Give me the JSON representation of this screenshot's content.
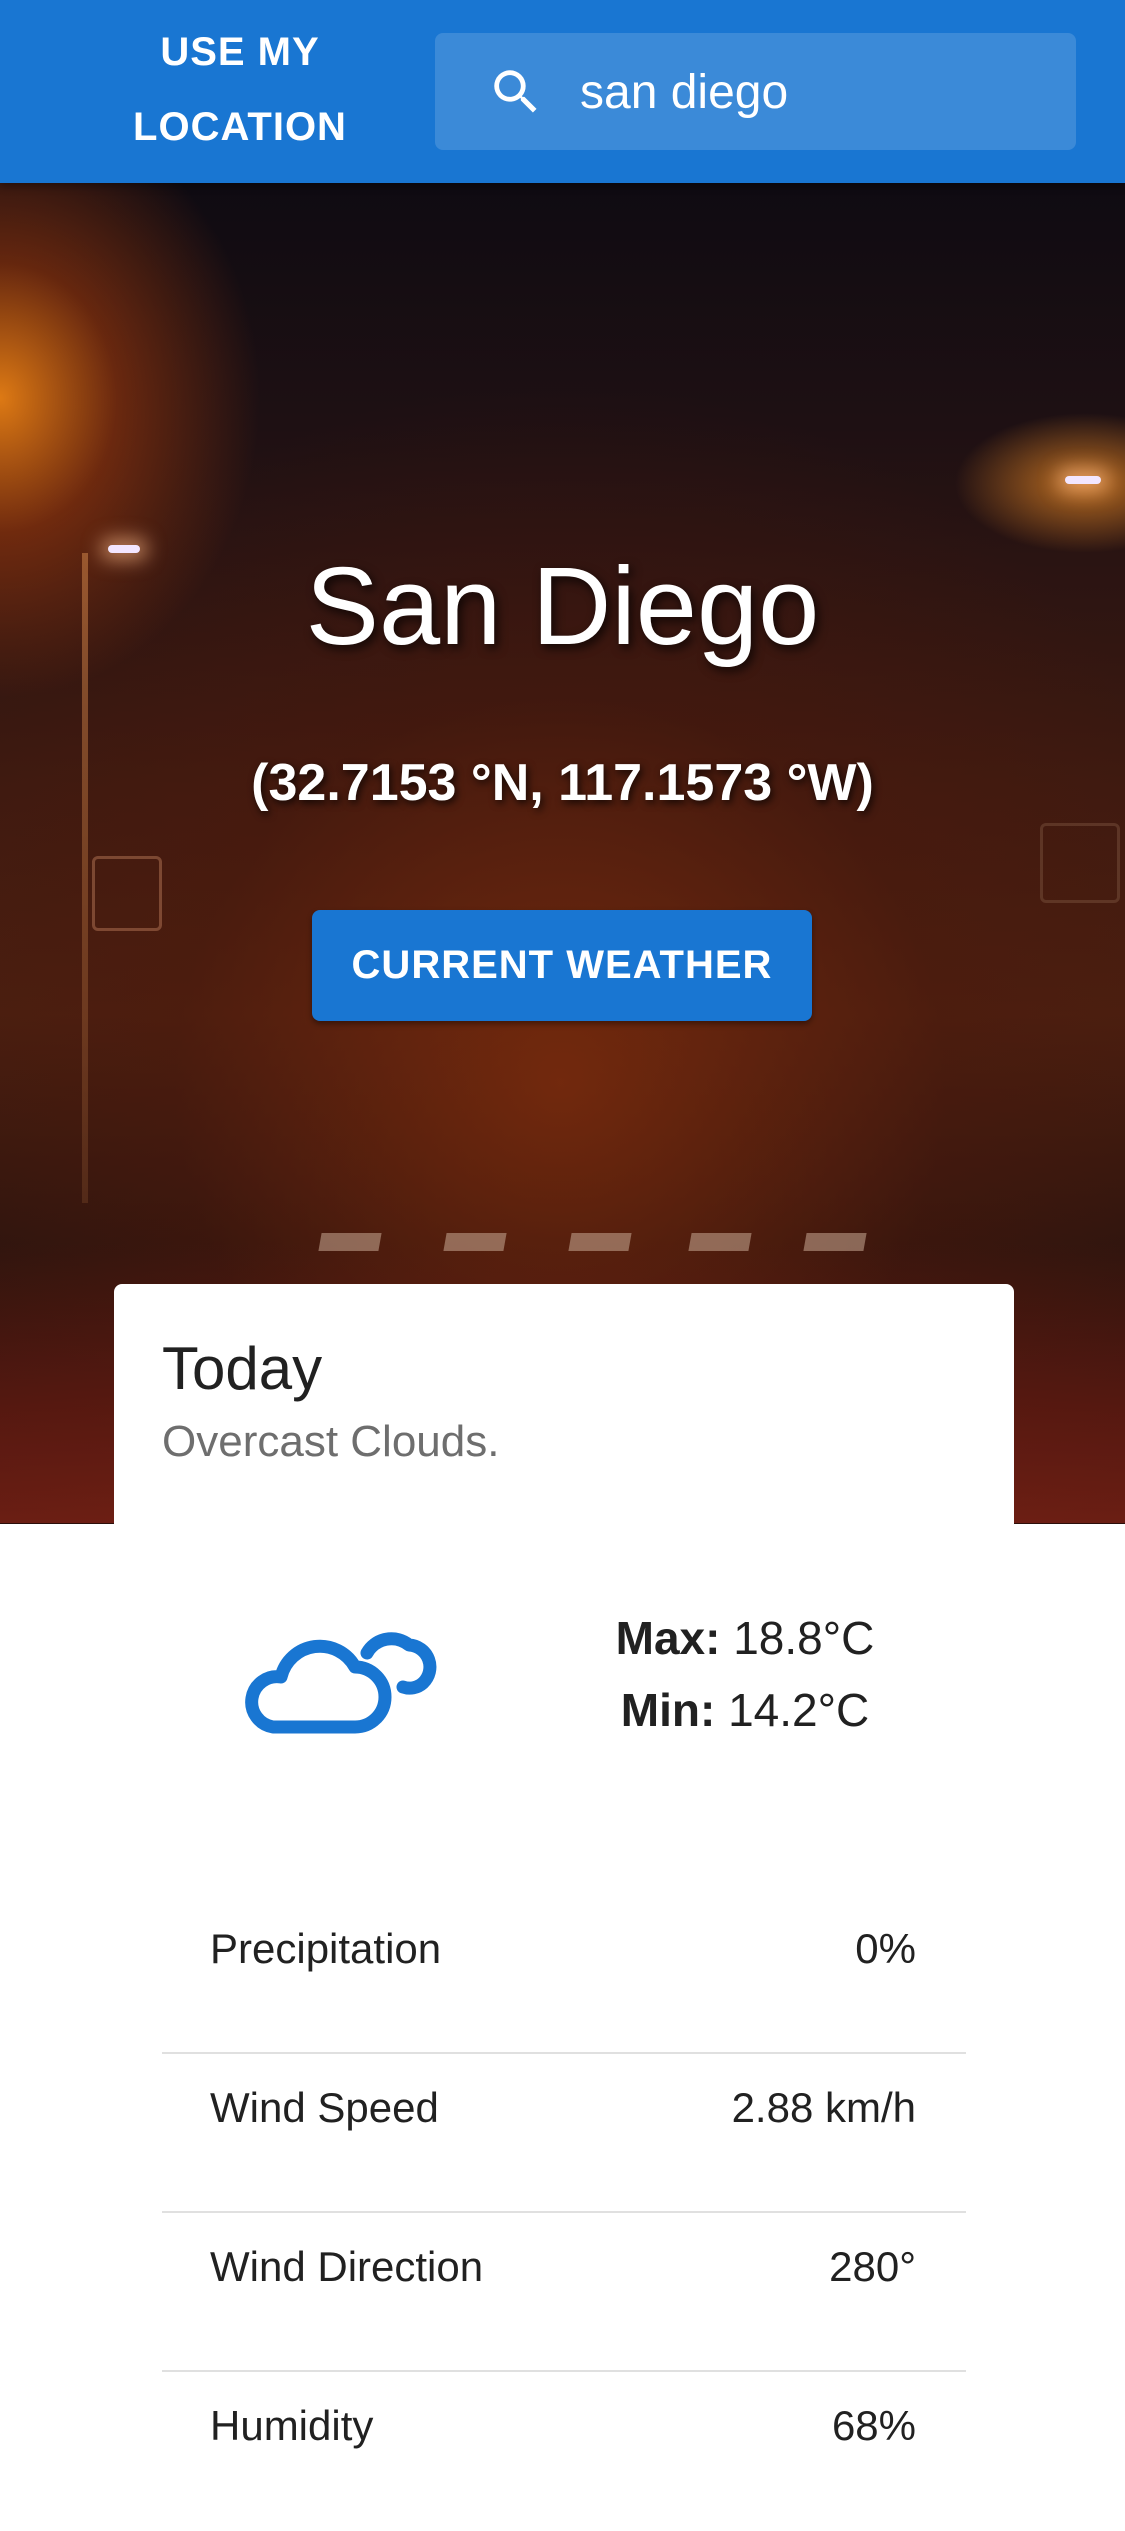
{
  "header": {
    "location_button_label": "USE MY\nLOCATION",
    "search": {
      "value": "san diego",
      "icon": "search-icon"
    }
  },
  "hero": {
    "city": "San Diego",
    "coordinates": "(32.7153 °N, 117.1573 °W)",
    "current_weather_label": "CURRENT WEATHER"
  },
  "today": {
    "title": "Today",
    "condition": "Overcast Clouds.",
    "icon": "cloud-icon",
    "max_label": "Max:",
    "max_value": "18.8°C",
    "min_label": "Min:",
    "min_value": "14.2°C"
  },
  "details": [
    {
      "label": "Precipitation",
      "value": "0%"
    },
    {
      "label": "Wind Speed",
      "value": "2.88 km/h"
    },
    {
      "label": "Wind Direction",
      "value": "280°"
    },
    {
      "label": "Humidity",
      "value": "68%"
    }
  ],
  "colors": {
    "primary": "#1976d2",
    "text": "#212121",
    "muted": "#6e6e6e"
  }
}
